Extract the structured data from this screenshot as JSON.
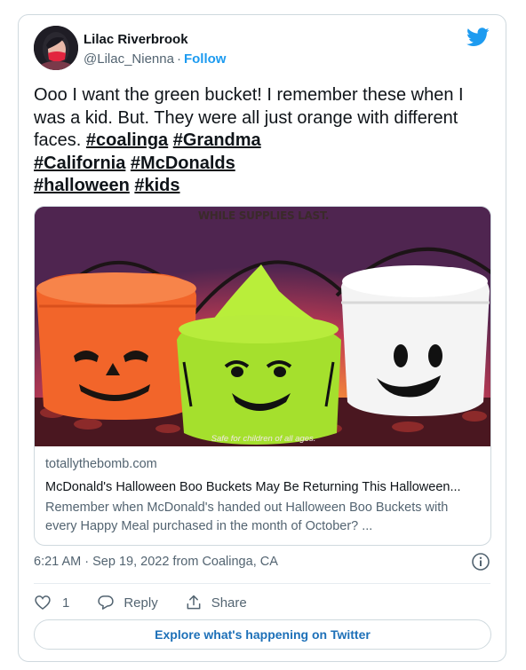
{
  "author": {
    "display_name": "Lilac Riverbrook",
    "handle": "@Lilac_Nienna",
    "separator": "·",
    "follow_label": "Follow"
  },
  "tweet": {
    "text_intro": "Ooo I want the green bucket! I remember these when I was a kid. But. They were all just orange with different faces.",
    "hashtags": [
      "#coalinga",
      "#Grandma",
      "#California",
      "#McDonalds",
      "#halloween",
      "#kids"
    ]
  },
  "link_preview": {
    "image_top_text": "WHILE SUPPLIES LAST.",
    "image_bottom_text": "Safe for children of all ages.",
    "domain": "totallythebomb.com",
    "title": "McDonald's Halloween Boo Buckets May Be Returning This Halloween...",
    "description": "Remember when McDonald's handed out Halloween Boo Buckets with every Happy Meal purchased in the month of October? ..."
  },
  "meta": {
    "time": "6:21 AM",
    "separator": "·",
    "date": "Sep 19, 2022",
    "location_prefix": "from",
    "location": "Coalinga, CA"
  },
  "actions": {
    "like_count": "1",
    "reply_label": "Reply",
    "share_label": "Share"
  },
  "explore_label": "Explore what's happening on Twitter",
  "colors": {
    "accent": "#1d9bf0",
    "text_primary": "#0f1419",
    "text_secondary": "#536471",
    "border": "#cfd9de",
    "explore_text": "#1d70b8"
  },
  "icons": {
    "brand": "twitter-bird-icon",
    "info": "info-icon",
    "like": "heart-icon",
    "reply": "speech-bubble-icon",
    "share": "upload-share-icon"
  }
}
